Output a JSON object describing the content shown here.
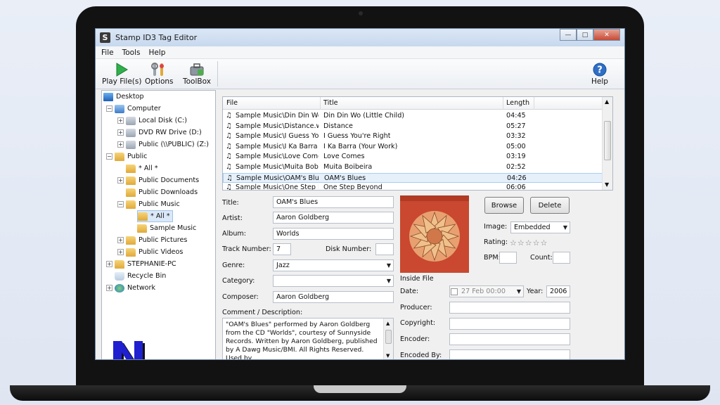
{
  "window": {
    "title": "Stamp ID3 Tag Editor",
    "logo_letter": "S",
    "minimize_glyph": "—",
    "maximize_glyph": "□",
    "close_glyph": "✕"
  },
  "menu": [
    "File",
    "Tools",
    "Help"
  ],
  "toolbar": {
    "play_label": "Play File(s)",
    "options_label": "Options",
    "toolbox_label": "ToolBox",
    "help_label": "Help"
  },
  "tree": [
    {
      "label": "Desktop"
    },
    {
      "label": "Computer"
    },
    {
      "label": "Local Disk (C:)"
    },
    {
      "label": "DVD RW Drive (D:)"
    },
    {
      "label": "Public (\\\\PUBLIC) (Z:)"
    },
    {
      "label": "Public"
    },
    {
      "label": "* All *"
    },
    {
      "label": "Public Documents"
    },
    {
      "label": "Public Downloads"
    },
    {
      "label": "Public Music"
    },
    {
      "label": "* All *"
    },
    {
      "label": "Sample Music"
    },
    {
      "label": "Public Pictures"
    },
    {
      "label": "Public Videos"
    },
    {
      "label": "STEPHANIE-PC"
    },
    {
      "label": "Recycle Bin"
    },
    {
      "label": "Network"
    }
  ],
  "filelist": {
    "headers": {
      "file": "File",
      "title": "Title",
      "length": "Length"
    },
    "rows": [
      {
        "file": "Sample Music\\Din Din Wo ...",
        "title": "Din Din Wo (Little Child)",
        "length": "04:45"
      },
      {
        "file": "Sample Music\\Distance.wma",
        "title": "Distance",
        "length": "05:27"
      },
      {
        "file": "Sample Music\\I Guess Yo...",
        "title": "I Guess You're Right",
        "length": "03:32"
      },
      {
        "file": "Sample Music\\I Ka Barra (...",
        "title": "I Ka Barra (Your Work)",
        "length": "05:00"
      },
      {
        "file": "Sample Music\\Love Come...",
        "title": "Love Comes",
        "length": "03:19"
      },
      {
        "file": "Sample Music\\Muita Bobei...",
        "title": "Muita Boibeira",
        "length": "02:52"
      },
      {
        "file": "Sample Music\\OAM's Blue...",
        "title": "OAM's Blues",
        "length": "04:26"
      },
      {
        "file": "Sample Music\\One Step B...",
        "title": "One Step Beyond",
        "length": "06:06"
      }
    ]
  },
  "form": {
    "title_label": "Title:",
    "title_value": "OAM's Blues",
    "artist_label": "Artist:",
    "artist_value": "Aaron Goldberg",
    "album_label": "Album:",
    "album_value": "Worlds",
    "track_label": "Track Number:",
    "track_value": "7",
    "disk_label": "Disk Number:",
    "disk_value": "",
    "genre_label": "Genre:",
    "genre_value": "Jazz",
    "category_label": "Category:",
    "category_value": "",
    "composer_label": "Composer:",
    "composer_value": "Aaron Goldberg",
    "comment_label": "Comment / Description:",
    "comment_value": "\"OAM's Blues\" performed by Aaron Goldberg from the CD \"Worlds\", courtesy of Sunnyside Records. Written by Aaron Goldberg, published by A Dawg Music/BMI.  All Rights Reserved.  Used by"
  },
  "right": {
    "browse_label": "Browse",
    "delete_label": "Delete",
    "image_label": "Image:",
    "image_value": "Embedded",
    "rating_label": "Rating:",
    "rating_value": 0,
    "rating_max": 5,
    "bpm_label": "BPM:",
    "bpm_value": "",
    "count_label": "Count:",
    "count_value": "",
    "inside_file_label": "Inside File",
    "date_label": "Date:",
    "date_value": "27 Feb 00:00",
    "year_label": "Year:",
    "year_value": "2006",
    "producer_label": "Producer:",
    "producer_value": "",
    "copyright_label": "Copyright:",
    "copyright_value": "",
    "encoder_label": "Encoder:",
    "encoder_value": "",
    "encodedby_label": "Encoded By:",
    "encodedby_value": ""
  },
  "colors": {
    "accent": "#2f7fd0",
    "selection": "#e5f0fb",
    "album_art": "#c9482f",
    "logo_blue": "#2020d0"
  },
  "icons": {
    "play": "play-icon",
    "options": "options-icon",
    "toolbox": "toolbox-icon",
    "help": "help-icon",
    "file": "music-note-icon"
  }
}
